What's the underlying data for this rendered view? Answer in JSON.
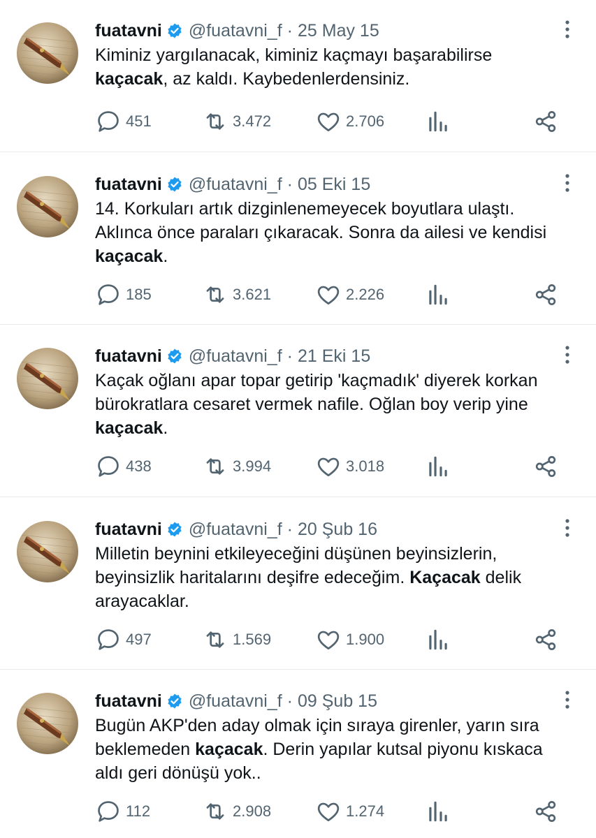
{
  "colors": {
    "text": "#0f1419",
    "secondary": "#536471",
    "verified": "#1d9bf0",
    "divider": "#e7e9ea"
  },
  "icons": [
    "reply-icon",
    "retweet-icon",
    "like-icon",
    "views-icon",
    "share-icon",
    "verified-badge-icon",
    "more-icon"
  ],
  "tweets": [
    {
      "name": "fuatavni",
      "handle": "@fuatavni_f",
      "dot": "·",
      "date": "25 May 15",
      "text": [
        [
          {
            "t": "Kiminiz yargılanacak, kiminiz kaçmayı başarabilirse"
          }
        ],
        [
          {
            "t": "kaçacak",
            "b": true
          },
          {
            "t": ", az kaldı. Kaybedenlerdensiniz."
          }
        ]
      ],
      "replies": "451",
      "retweets": "3.472",
      "likes": "2.706"
    },
    {
      "name": "fuatavni",
      "handle": "@fuatavni_f",
      "dot": "·",
      "date": "05 Eki 15",
      "text": [
        [
          {
            "t": "14. Korkuları artık dizginlenemeyecek boyutlara ulaştı."
          }
        ],
        [
          {
            "t": "Aklınca önce paraları çıkaracak. Sonra da ailesi ve kendisi"
          }
        ],
        [
          {
            "t": "kaçacak",
            "b": true
          },
          {
            "t": "."
          }
        ]
      ],
      "replies": "185",
      "retweets": "3.621",
      "likes": "2.226"
    },
    {
      "name": "fuatavni",
      "handle": "@fuatavni_f",
      "dot": "·",
      "date": "21 Eki 15",
      "text": [
        [
          {
            "t": "Kaçak oğlanı apar topar getirip 'kaçmadık' diyerek korkan"
          }
        ],
        [
          {
            "t": "bürokratlara cesaret vermek nafile. Oğlan boy verip yine"
          }
        ],
        [
          {
            "t": "kaçacak",
            "b": true
          },
          {
            "t": "."
          }
        ]
      ],
      "replies": "438",
      "retweets": "3.994",
      "likes": "3.018"
    },
    {
      "name": "fuatavni",
      "handle": "@fuatavni_f",
      "dot": "·",
      "date": "20 Şub 16",
      "text": [
        [
          {
            "t": "Milletin beynini etkileyeceğini düşünen beyinsizlerin,"
          }
        ],
        [
          {
            "t": "beyinsizlik haritalarını deşifre edeceğim. "
          },
          {
            "t": "Kaçacak",
            "b": true
          },
          {
            "t": " delik"
          }
        ],
        [
          {
            "t": "arayacaklar."
          }
        ]
      ],
      "replies": "497",
      "retweets": "1.569",
      "likes": "1.900"
    },
    {
      "name": "fuatavni",
      "handle": "@fuatavni_f",
      "dot": "·",
      "date": "09 Şub 15",
      "text": [
        [
          {
            "t": "Bugün AKP'den aday olmak için sıraya girenler, yarın sıra"
          }
        ],
        [
          {
            "t": "beklemeden "
          },
          {
            "t": "kaçacak",
            "b": true
          },
          {
            "t": ". Derin yapılar kutsal piyonu kıskaca"
          }
        ],
        [
          {
            "t": "aldı geri dönüşü yok.."
          }
        ]
      ],
      "replies": "112",
      "retweets": "2.908",
      "likes": "1.274"
    }
  ]
}
